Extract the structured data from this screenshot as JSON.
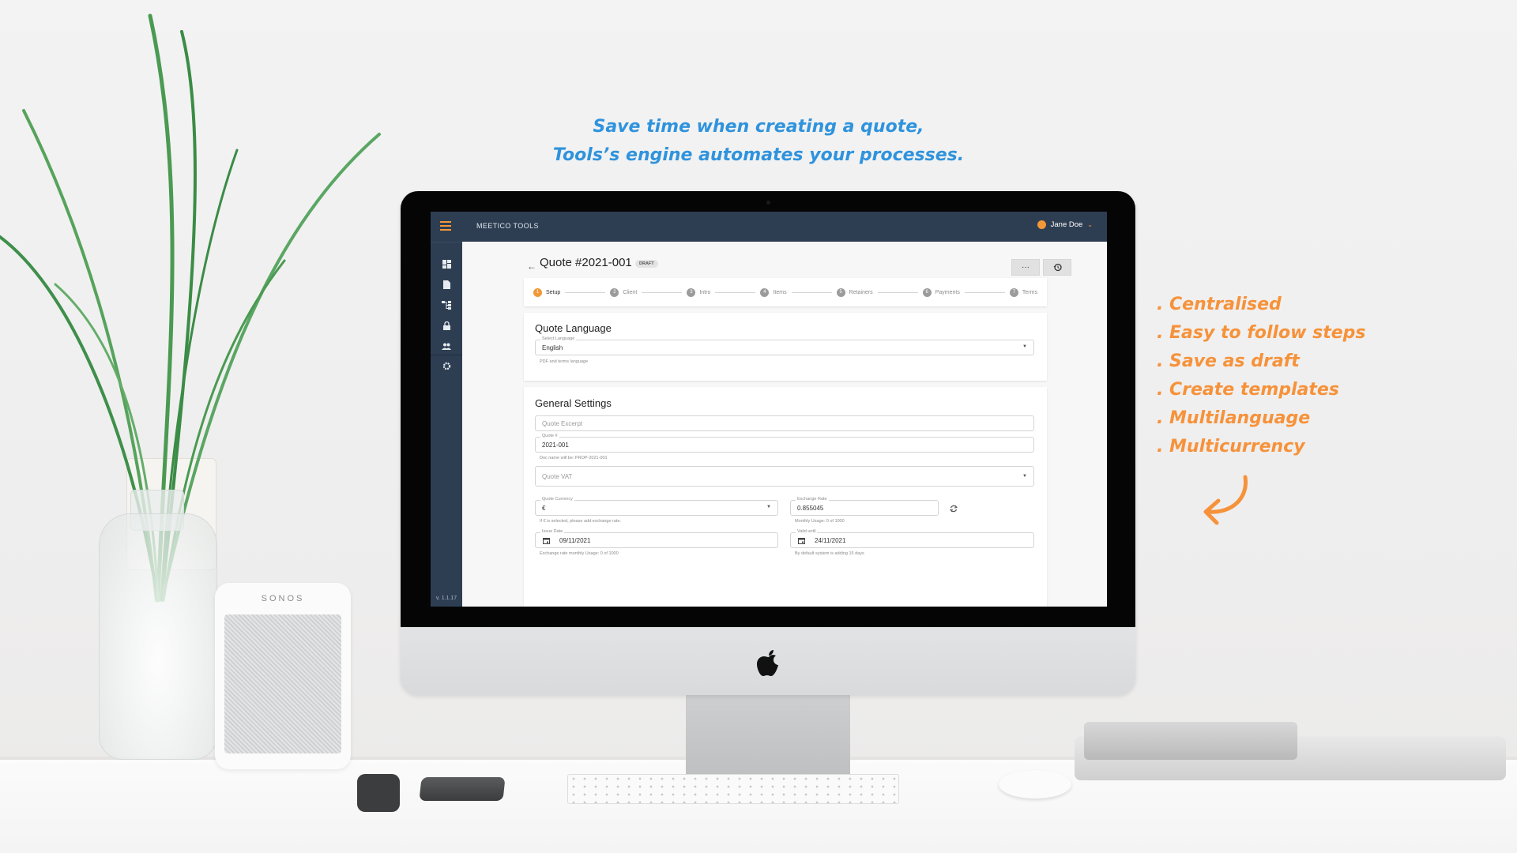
{
  "marketing": {
    "headline_line1": "Save time when creating a quote,",
    "headline_line2": "Tools’s engine automates your processes.",
    "features": [
      ". Centralised",
      ". Easy to follow steps",
      ". Save as draft",
      ". Create templates",
      ". Multilanguage",
      ". Multicurrency"
    ],
    "speaker_brand": "SONOS",
    "colors": {
      "headline": "#2f93dd",
      "features": "#f6923a"
    }
  },
  "app": {
    "title": "MEETICO TOOLS",
    "user": {
      "name": "Jane Doe",
      "icon": "user-circle-icon"
    },
    "version": "v. 1.1.17",
    "colors": {
      "topbar": "#2e3e52",
      "accent": "#f29838"
    },
    "sidebar": {
      "items": [
        {
          "icon": "dashboard-icon"
        },
        {
          "icon": "document-icon"
        },
        {
          "icon": "workflow-icon"
        },
        {
          "icon": "lock-icon"
        },
        {
          "icon": "users-icon"
        },
        {
          "icon": "settings-icon"
        }
      ]
    },
    "page": {
      "back_icon": "arrow-left-icon",
      "title": "Quote #2021-001",
      "status_badge": "DRAFT",
      "more_label": "···",
      "history_icon": "history-icon"
    },
    "stepper": {
      "steps": [
        {
          "num": "1",
          "label": "Setup",
          "active": true
        },
        {
          "num": "2",
          "label": "Client",
          "active": false
        },
        {
          "num": "3",
          "label": "Intro",
          "active": false
        },
        {
          "num": "4",
          "label": "Items",
          "active": false
        },
        {
          "num": "5",
          "label": "Retainers",
          "active": false
        },
        {
          "num": "6",
          "label": "Payments",
          "active": false
        },
        {
          "num": "7",
          "label": "Terms",
          "active": false
        }
      ]
    },
    "quote_language": {
      "title": "Quote Language",
      "select_label": "Select Language",
      "select_value": "English",
      "hint": "PDF and terms language"
    },
    "general_settings": {
      "title": "General Settings",
      "excerpt_placeholder": "Quote Excerpt",
      "quote_number_label": "Quote #",
      "quote_number_value": "2021-001",
      "quote_number_hint": "Doc name will be: PROP-2021-001",
      "vat_placeholder": "Quote VAT",
      "currency_label": "Quote Currency",
      "currency_value": "€",
      "currency_hint": "If € is selected, please add exchange rate.",
      "exchange_rate_label": "Exchange Rate",
      "exchange_rate_value": "0.855045",
      "exchange_rate_hint": "Monthly Usage: 0 of 1000",
      "issue_date_label": "Issue Date",
      "issue_date_value": "09/11/2021",
      "issue_date_hint": "Exchange rate monthly Usage: 0 of 1000",
      "valid_until_label": "Valid until",
      "valid_until_value": "24/11/2021",
      "valid_until_hint": "By default system is adding 15 days"
    }
  }
}
